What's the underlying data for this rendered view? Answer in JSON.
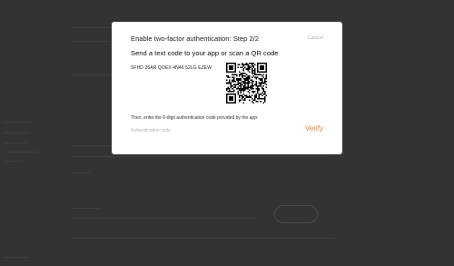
{
  "modal": {
    "title": "Enable two-factor authentication: Step 2/2",
    "cancel_label": "Cancel",
    "subtitle": "Send a text code to your app or scan a QR code",
    "secret_code": "SFHD 26AR QOEX 4N46 52LG EZEW",
    "instruction": "Then, enter the 6-digit authentication code provided by the app:",
    "code_input_placeholder": "Authentication code",
    "code_input_value": "",
    "verify_label": "Verify"
  },
  "colors": {
    "overlay": "#333333",
    "modal_bg": "#ffffff",
    "accent": "#f07f3c"
  }
}
